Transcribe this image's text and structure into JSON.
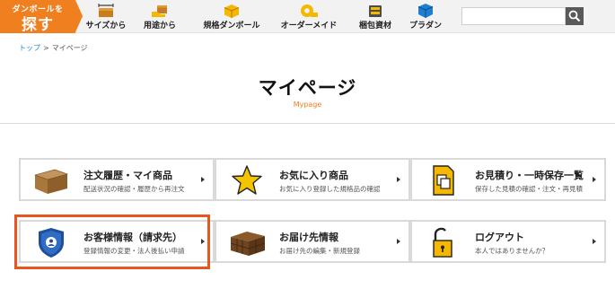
{
  "nav": {
    "search_badge": {
      "small": "ダンボールを",
      "big": "探す"
    },
    "items": [
      {
        "label": "サイズから",
        "icon": "ruler-box-icon"
      },
      {
        "label": "用途から",
        "icon": "hand-box-icon"
      },
      {
        "label": "規格ダンボール",
        "icon": "cube-box-icon"
      },
      {
        "label": "オーダーメイド",
        "icon": "tape-roll-icon"
      },
      {
        "label": "梱包資材",
        "icon": "packing-material-icon"
      },
      {
        "label": "プラダン",
        "icon": "plastic-cube-icon"
      }
    ],
    "search": {
      "value": "",
      "placeholder": ""
    }
  },
  "breadcrumb": {
    "home": "トップ",
    "separator": ">",
    "current": "マイページ"
  },
  "page": {
    "title": "マイページ",
    "subtitle": "Mypage"
  },
  "cards": [
    {
      "title": "注文履歴・マイ商品",
      "sub": "配送状況の確認・履歴から再注文",
      "icon": "cardboard-box-icon"
    },
    {
      "title": "お気に入り商品",
      "sub": "お気に入り登録した規格品の確認",
      "icon": "star-icon"
    },
    {
      "title": "お見積り・一時保存一覧",
      "sub": "保存した見積の確認・注文・再見積",
      "icon": "documents-icon"
    },
    {
      "title": "お客様情報（請求先）",
      "sub": "登録情報の変更・法人後払い申請",
      "icon": "user-shield-icon"
    },
    {
      "title": "お届け先情報",
      "sub": "お届け先の編集・新規登録",
      "icon": "stacked-boxes-icon"
    },
    {
      "title": "ログアウト",
      "sub": "本人ではありませんか？",
      "icon": "unlocked-padlock-icon"
    }
  ],
  "colors": {
    "accent": "#f07f1f",
    "highlight": "#e8551f",
    "icon_yellow": "#f5b800",
    "shield_blue": "#1f4f9c"
  }
}
